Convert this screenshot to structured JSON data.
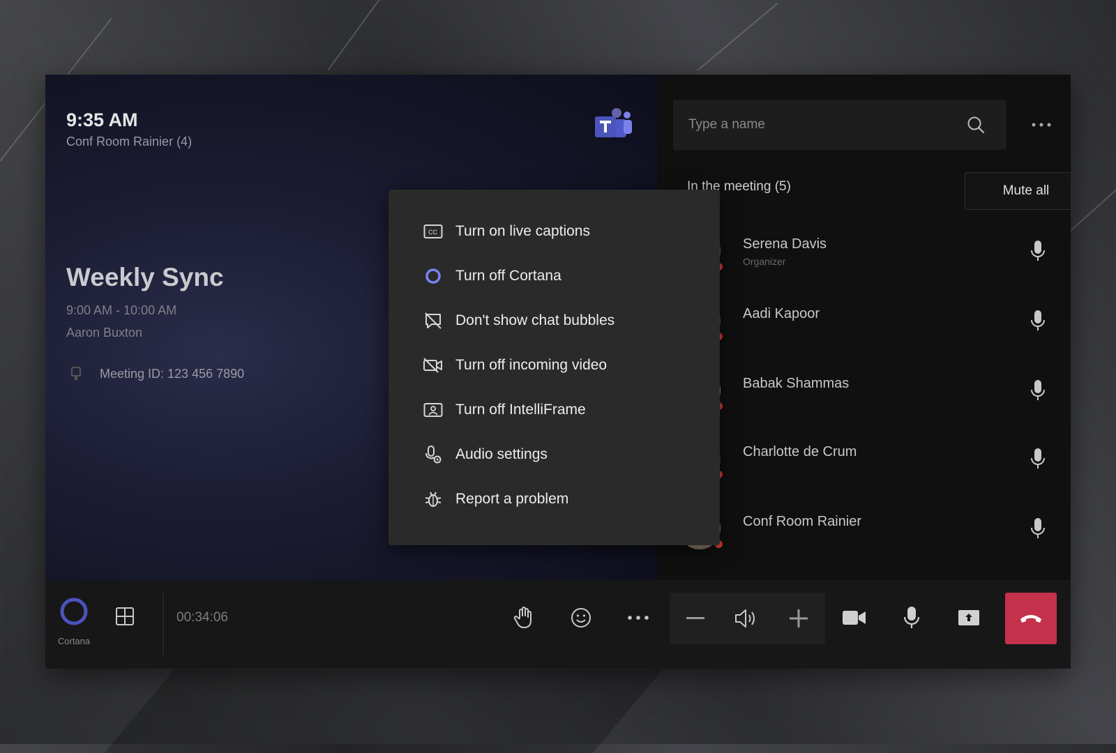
{
  "meeting": {
    "clock": "9:35 AM",
    "room": "Conf Room Rainier (4)",
    "title": "Weekly Sync",
    "time_range": "9:00 AM - 10:00 AM",
    "organizer": "Aaron Buxton",
    "meeting_id": "Meeting ID: 123 456 7890"
  },
  "menu": {
    "items": [
      {
        "label": "Turn on live captions",
        "icon": "captions-icon"
      },
      {
        "label": "Turn off Cortana",
        "icon": "cortana-ring-icon"
      },
      {
        "label": "Don't show chat bubbles",
        "icon": "chat-bubble-off-icon"
      },
      {
        "label": "Turn off incoming video",
        "icon": "video-off-icon"
      },
      {
        "label": "Turn off IntelliFrame",
        "icon": "intelliframe-icon"
      },
      {
        "label": "Audio settings",
        "icon": "audio-settings-icon"
      },
      {
        "label": "Report a problem",
        "icon": "bug-icon"
      }
    ]
  },
  "roster": {
    "search_placeholder": "Type a name",
    "section_label": "In the meeting (5)",
    "mute_all_label": "Mute all",
    "participants": [
      {
        "name": "Serena Davis",
        "role": "Organizer"
      },
      {
        "name": "Aadi Kapoor",
        "role": ""
      },
      {
        "name": "Babak Shammas",
        "role": ""
      },
      {
        "name": "Charlotte de Crum",
        "role": ""
      },
      {
        "name": "Conf Room Rainier",
        "role": ""
      }
    ]
  },
  "controls": {
    "cortana_label": "Cortana",
    "duration": "00:34:06"
  },
  "colors": {
    "accent": "#6264a7",
    "hangup": "#c4314b",
    "status_dot": "#d73b3e"
  }
}
